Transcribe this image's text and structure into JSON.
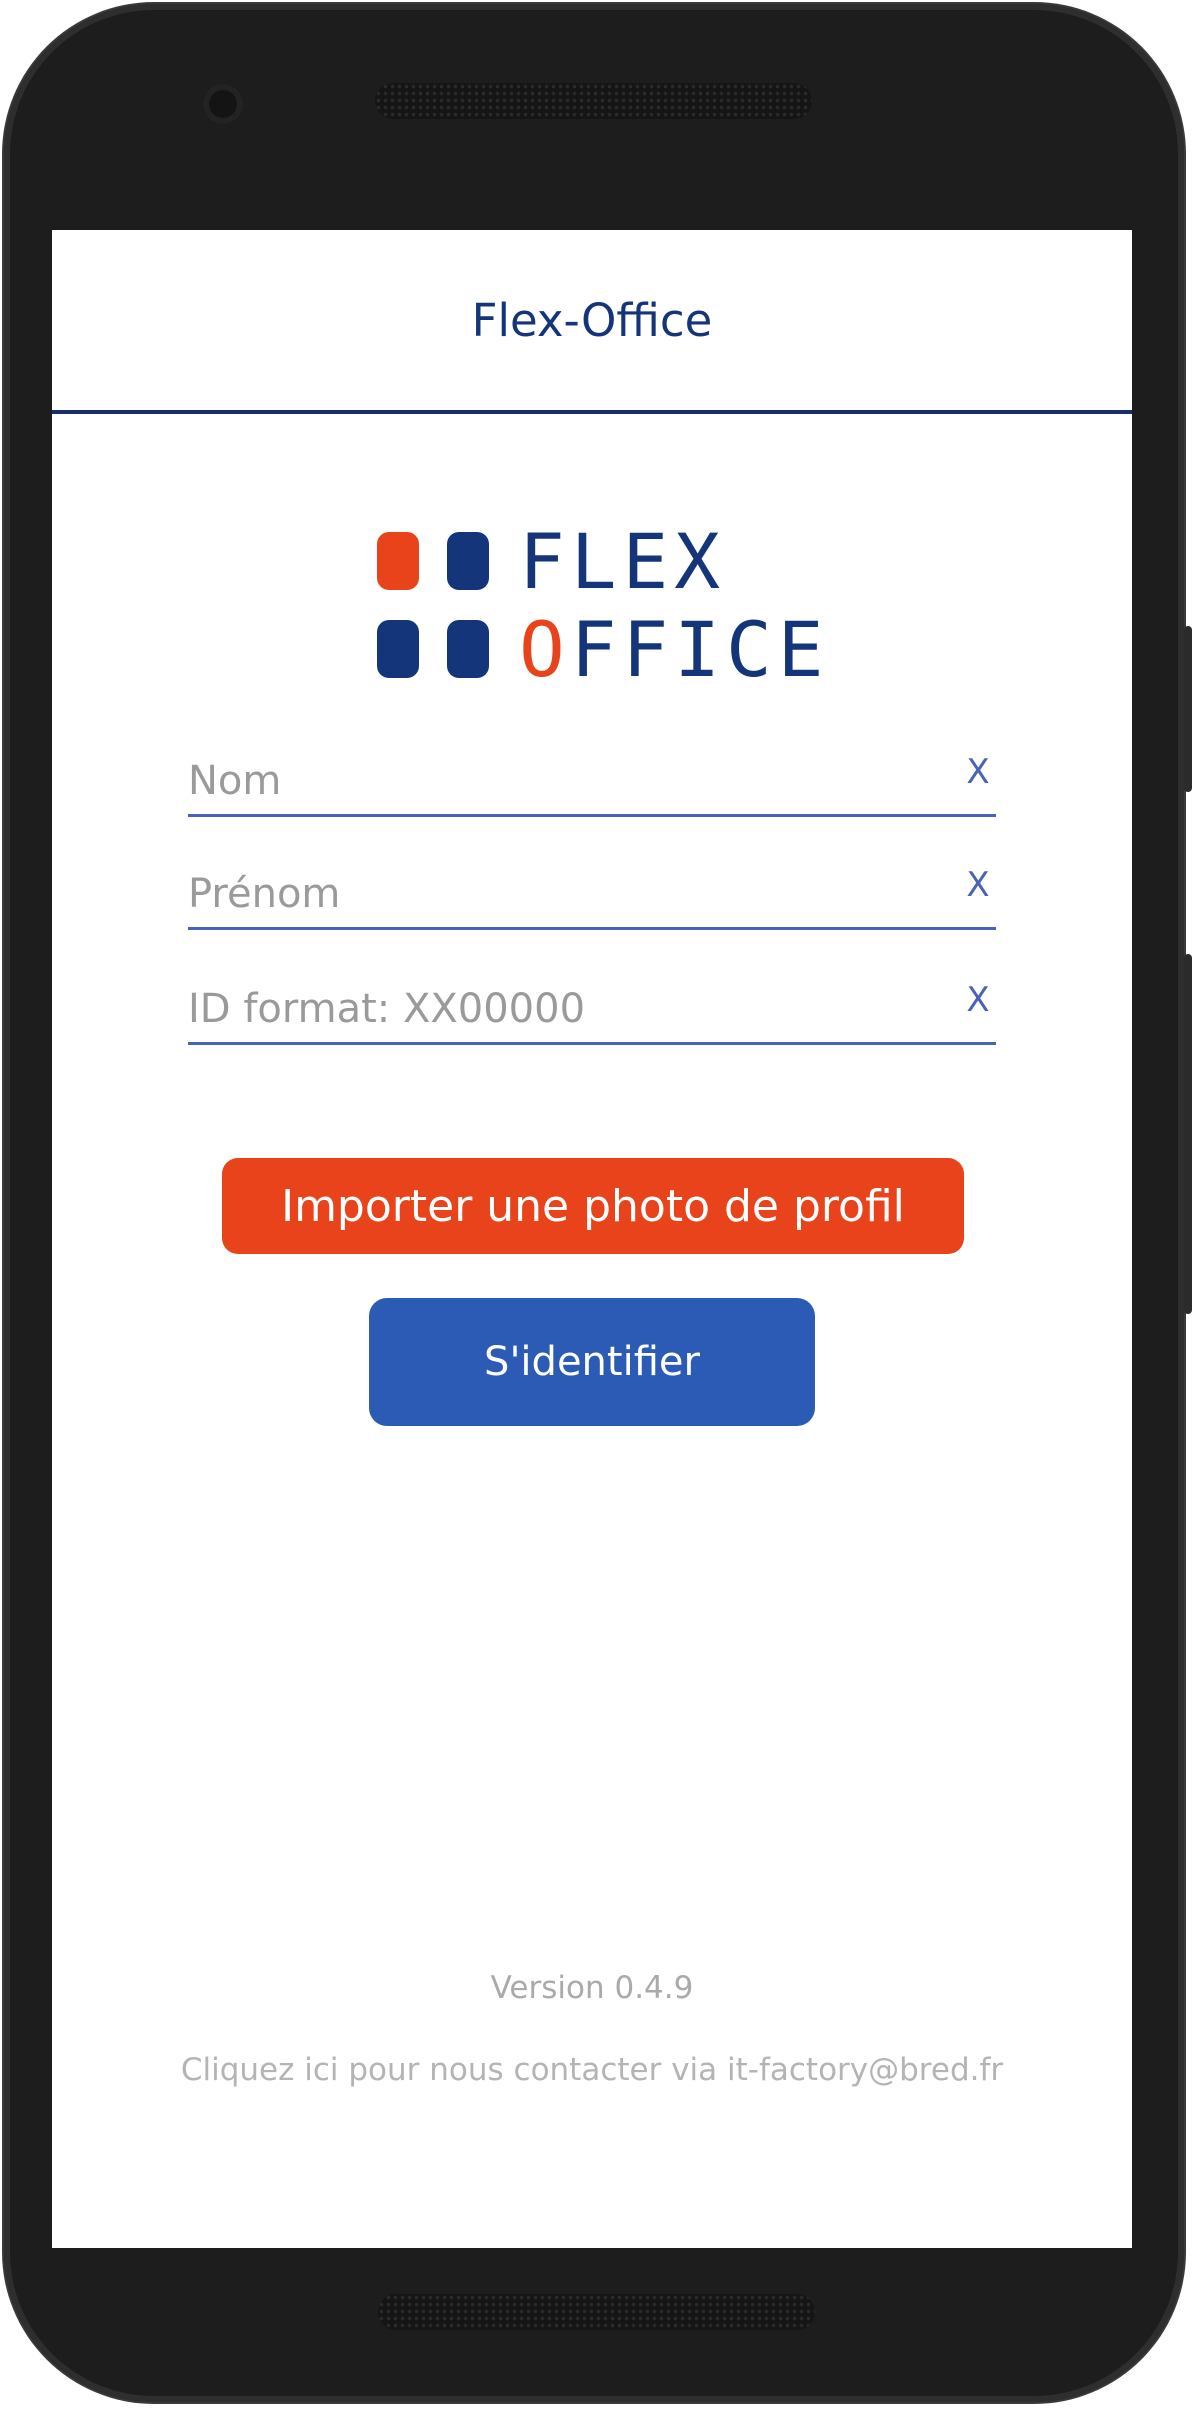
{
  "header": {
    "title": "Flex-Office"
  },
  "logo": {
    "line1": "FLEX",
    "line2_accent": "O",
    "line2_rest": "FFICE",
    "colors": {
      "orange": "#e8431b",
      "navy": "#14357a"
    }
  },
  "form": {
    "nom": {
      "placeholder": "Nom",
      "value": "",
      "clear_label": "X"
    },
    "prenom": {
      "placeholder": "Prénom",
      "value": "",
      "clear_label": "X"
    },
    "id": {
      "placeholder": "ID format: XX00000",
      "value": "",
      "clear_label": "X"
    }
  },
  "buttons": {
    "photo_label": "Importer une photo de profil",
    "login_label": "S'identifier"
  },
  "footer": {
    "version": "Version 0.4.9",
    "contact": "Cliquez ici pour nous contacter via it-factory@bred.fr"
  },
  "colors": {
    "accent_orange": "#e8431b",
    "primary_blue": "#2b5bb5",
    "header_navy": "#14357a"
  }
}
